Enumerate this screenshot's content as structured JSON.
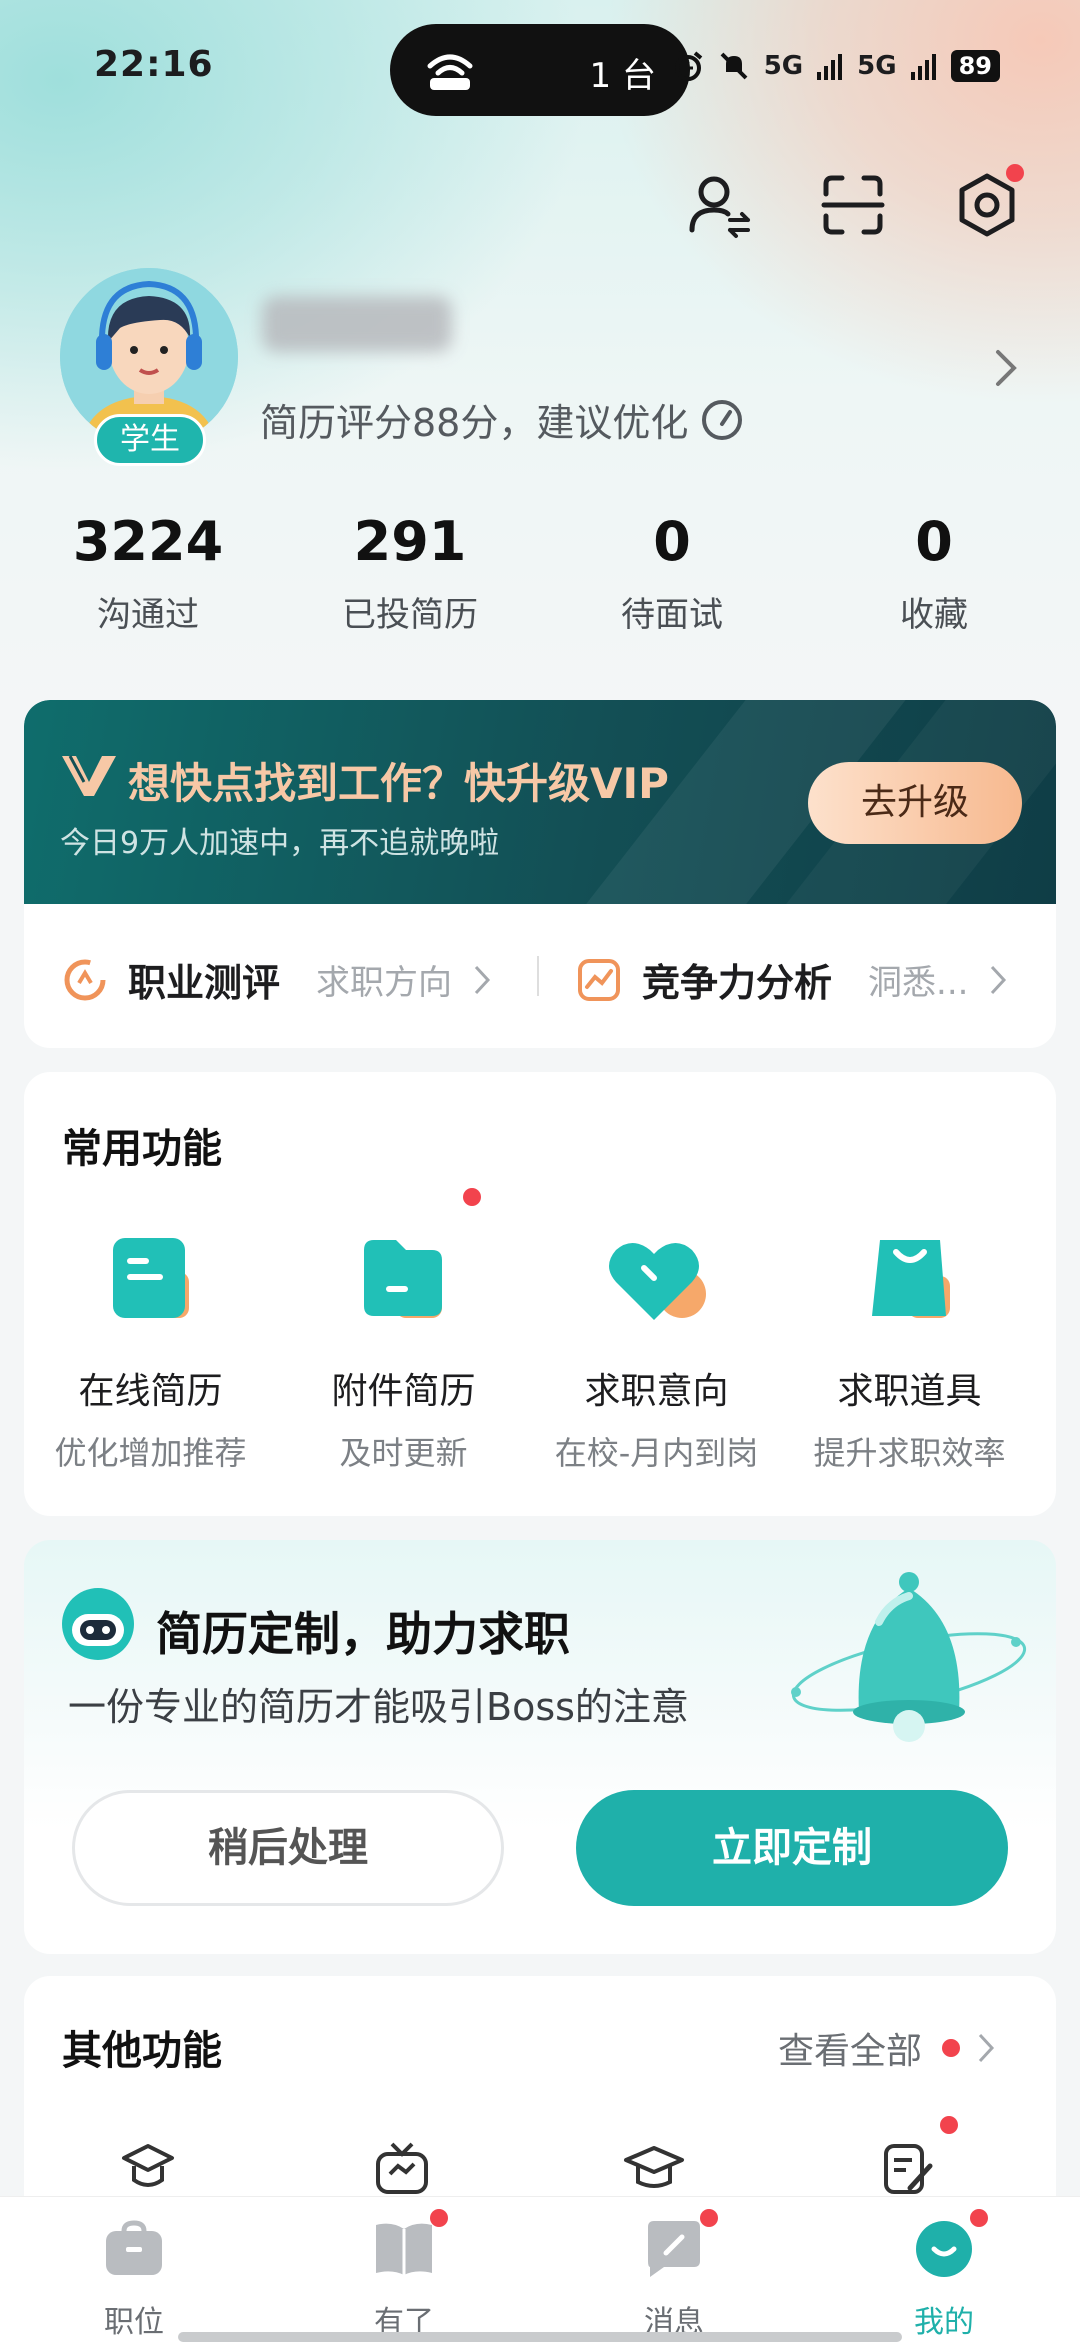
{
  "status_bar": {
    "time": "22:16",
    "island_text": "1 台",
    "signal_1": "5G",
    "signal_2": "5G",
    "battery": "89"
  },
  "profile": {
    "badge": "学生",
    "resume_score_text": "简历评分88分，建议优化"
  },
  "stats": [
    {
      "value": "3224",
      "label": "沟通过"
    },
    {
      "value": "291",
      "label": "已投简历"
    },
    {
      "value": "0",
      "label": "待面试"
    },
    {
      "value": "0",
      "label": "收藏"
    }
  ],
  "vip": {
    "title": "想快点找到工作？快升级VIP",
    "subtitle": "今日9万人加速中，再不追就晚啦",
    "button": "去升级"
  },
  "eval": {
    "career_title": "职业测评",
    "career_desc": "求职方向",
    "compete_title": "竞争力分析",
    "compete_desc": "洞悉..."
  },
  "common": {
    "title": "常用功能",
    "items": [
      {
        "name": "在线简历",
        "desc": "优化增加推荐"
      },
      {
        "name": "附件简历",
        "desc": "及时更新"
      },
      {
        "name": "求职意向",
        "desc": "在校-月内到岗"
      },
      {
        "name": "求职道具",
        "desc": "提升求职效率"
      }
    ]
  },
  "custom": {
    "title": "简历定制，助力求职",
    "subtitle": "一份专业的简历才能吸引Boss的注意",
    "later": "稍后处理",
    "now": "立即定制"
  },
  "other": {
    "title": "其他功能",
    "view_all": "查看全部"
  },
  "nav": [
    {
      "label": "职位"
    },
    {
      "label": "有了"
    },
    {
      "label": "消息"
    },
    {
      "label": "我的"
    }
  ],
  "colors": {
    "accent": "#1fb0aa",
    "vip_gold": "#f7c8a6",
    "badge_red": "#f2434d"
  }
}
